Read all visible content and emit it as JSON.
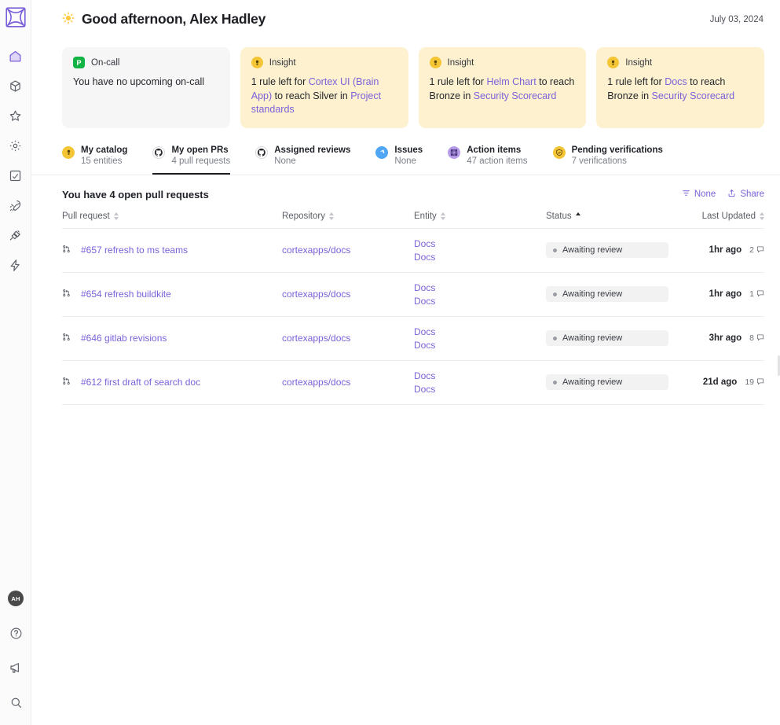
{
  "app": {
    "logo_icon": "cortex-logo-icon"
  },
  "rail": {
    "items": [
      {
        "name": "home",
        "icon": "home-icon",
        "active": true
      },
      {
        "name": "catalog",
        "icon": "cube-icon",
        "active": false
      },
      {
        "name": "scorecards",
        "icon": "star-icon",
        "active": false
      },
      {
        "name": "settings",
        "icon": "gear-icon",
        "active": false
      },
      {
        "name": "reports",
        "icon": "card-icon",
        "active": false
      },
      {
        "name": "initiatives",
        "icon": "rocket-icon",
        "active": false
      },
      {
        "name": "plugins",
        "icon": "plug-icon",
        "active": false
      },
      {
        "name": "workflows",
        "icon": "lightning-icon",
        "active": false
      }
    ],
    "bottom": [
      {
        "name": "user-avatar",
        "icon": "avatar",
        "label": "AH"
      },
      {
        "name": "help",
        "icon": "question-circle-icon"
      },
      {
        "name": "announcements",
        "icon": "megaphone-icon"
      },
      {
        "name": "search",
        "icon": "search-icon"
      }
    ]
  },
  "header": {
    "emoji": "🌤",
    "greeting": "Good afternoon, Alex Hadley",
    "date": "July 03, 2024"
  },
  "cards": [
    {
      "type": "oncall",
      "badge_icon": "pagerduty-icon",
      "badge_text": "P",
      "label": "On-call",
      "segments": [
        {
          "text": "You have no upcoming on-call",
          "link": false
        }
      ]
    },
    {
      "type": "insight",
      "badge_icon": "lightbulb-icon",
      "label": "Insight",
      "segments": [
        {
          "text": "1 rule left for ",
          "link": false
        },
        {
          "text": "Cortex UI (Brain App)",
          "link": true
        },
        {
          "text": " to reach Silver in ",
          "link": false
        },
        {
          "text": "Project standards",
          "link": true
        }
      ]
    },
    {
      "type": "insight",
      "badge_icon": "lightbulb-icon",
      "label": "Insight",
      "segments": [
        {
          "text": "1 rule left for ",
          "link": false
        },
        {
          "text": "Helm Chart",
          "link": true
        },
        {
          "text": " to reach Bronze in ",
          "link": false
        },
        {
          "text": "Security Scorecard",
          "link": true
        }
      ]
    },
    {
      "type": "insight",
      "badge_icon": "lightbulb-icon",
      "label": "Insight",
      "segments": [
        {
          "text": "1 rule left for ",
          "link": false
        },
        {
          "text": "Docs",
          "link": true
        },
        {
          "text": " to reach Bronze in ",
          "link": false
        },
        {
          "text": "Security Scorecard",
          "link": true
        }
      ]
    }
  ],
  "tabs": [
    {
      "key": "my-catalog",
      "label": "My catalog",
      "sub": "15 entities",
      "icon": "lightbulb-icon",
      "icon_style": "ti-yellow",
      "active": false
    },
    {
      "key": "my-open-prs",
      "label": "My open PRs",
      "sub": "4 pull requests",
      "icon": "github-icon",
      "icon_style": "ti-white",
      "active": true
    },
    {
      "key": "assigned-reviews",
      "label": "Assigned reviews",
      "sub": "None",
      "icon": "github-icon",
      "icon_style": "ti-white",
      "active": false
    },
    {
      "key": "issues",
      "label": "Issues",
      "sub": "None",
      "icon": "jira-icon",
      "icon_style": "ti-blue",
      "active": false
    },
    {
      "key": "action-items",
      "label": "Action items",
      "sub": "47 action items",
      "icon": "cortex-icon",
      "icon_style": "ti-purple",
      "active": false
    },
    {
      "key": "pending-verifications",
      "label": "Pending verifications",
      "sub": "7 verifications",
      "icon": "shield-check-icon",
      "icon_style": "ti-gold",
      "active": false
    }
  ],
  "list": {
    "title": "You have 4 open pull requests",
    "filter_label": "None",
    "filter_icon": "filter-icon",
    "share_label": "Share",
    "share_icon": "share-icon",
    "columns": [
      {
        "key": "pull_request",
        "label": "Pull request",
        "sort": "none"
      },
      {
        "key": "repository",
        "label": "Repository",
        "sort": "none"
      },
      {
        "key": "entity",
        "label": "Entity",
        "sort": "none"
      },
      {
        "key": "status",
        "label": "Status",
        "sort": "asc"
      },
      {
        "key": "last_updated",
        "label": "Last Updated",
        "sort": "none"
      }
    ],
    "rows": [
      {
        "icon": "pull-request-icon",
        "pull_request": "#657 refresh to ms teams",
        "repository": "cortexapps/docs",
        "entities": [
          "Docs",
          "Docs"
        ],
        "status": "Awaiting review",
        "last_updated": "1hr ago",
        "comments": "2"
      },
      {
        "icon": "pull-request-icon",
        "pull_request": "#654 refresh buildkite",
        "repository": "cortexapps/docs",
        "entities": [
          "Docs",
          "Docs"
        ],
        "status": "Awaiting review",
        "last_updated": "1hr ago",
        "comments": "1"
      },
      {
        "icon": "pull-request-icon",
        "pull_request": "#646 gitlab revisions",
        "repository": "cortexapps/docs",
        "entities": [
          "Docs",
          "Docs"
        ],
        "status": "Awaiting review",
        "last_updated": "3hr ago",
        "comments": "8"
      },
      {
        "icon": "pull-request-icon",
        "pull_request": "#612 first draft of search doc",
        "repository": "cortexapps/docs",
        "entities": [
          "Docs",
          "Docs"
        ],
        "status": "Awaiting review",
        "last_updated": "21d ago",
        "comments": "19"
      }
    ]
  },
  "colors": {
    "accent": "#7b61d9",
    "insight_bg": "#fdf1d0",
    "badge_yellow": "#f4c534",
    "oncall_green": "#12b445",
    "status_bg": "#f2f2f3"
  }
}
